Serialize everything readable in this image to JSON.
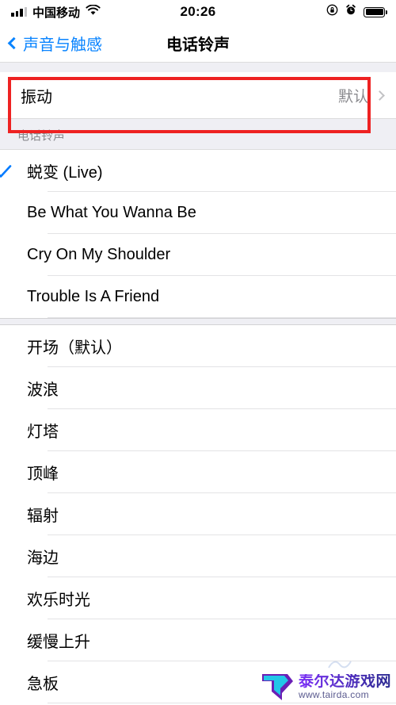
{
  "status_bar": {
    "carrier": "中国移动",
    "time": "20:26",
    "signal_icon": "cellular-signal-icon",
    "wifi_icon": "wifi-icon",
    "rotation_lock_icon": "rotation-lock-icon",
    "alarm_icon": "alarm-clock-icon",
    "battery_icon": "battery-icon"
  },
  "nav": {
    "back_label": "声音与触感",
    "title": "电话铃声",
    "back_icon": "chevron-left-icon"
  },
  "vibration_row": {
    "label": "振动",
    "value": "默认",
    "chevron_icon": "chevron-right-icon"
  },
  "section": {
    "header": "电话铃声"
  },
  "ringtones_custom": [
    {
      "label": "蜕变 (Live)",
      "selected": true
    },
    {
      "label": "Be What You Wanna Be",
      "selected": false
    },
    {
      "label": "Cry On My Shoulder",
      "selected": false
    },
    {
      "label": "Trouble Is A Friend",
      "selected": false
    }
  ],
  "ringtones_system": [
    {
      "label": "开场（默认）",
      "selected": false
    },
    {
      "label": "波浪",
      "selected": false
    },
    {
      "label": "灯塔",
      "selected": false
    },
    {
      "label": "顶峰",
      "selected": false
    },
    {
      "label": "辐射",
      "selected": false
    },
    {
      "label": "海边",
      "selected": false
    },
    {
      "label": "欢乐时光",
      "selected": false
    },
    {
      "label": "缓慢上升",
      "selected": false
    },
    {
      "label": "急板",
      "selected": false
    }
  ],
  "watermark": {
    "title": "泰尔达游戏网",
    "url": "www.tairda.com"
  },
  "colors": {
    "accent": "#007AFF",
    "nav_tint": "#0A84FF",
    "group_bg": "#EFEFF4",
    "annotation": "#EE2222",
    "separator": "#E3E3E5",
    "secondary_text": "#8A8A8E"
  }
}
